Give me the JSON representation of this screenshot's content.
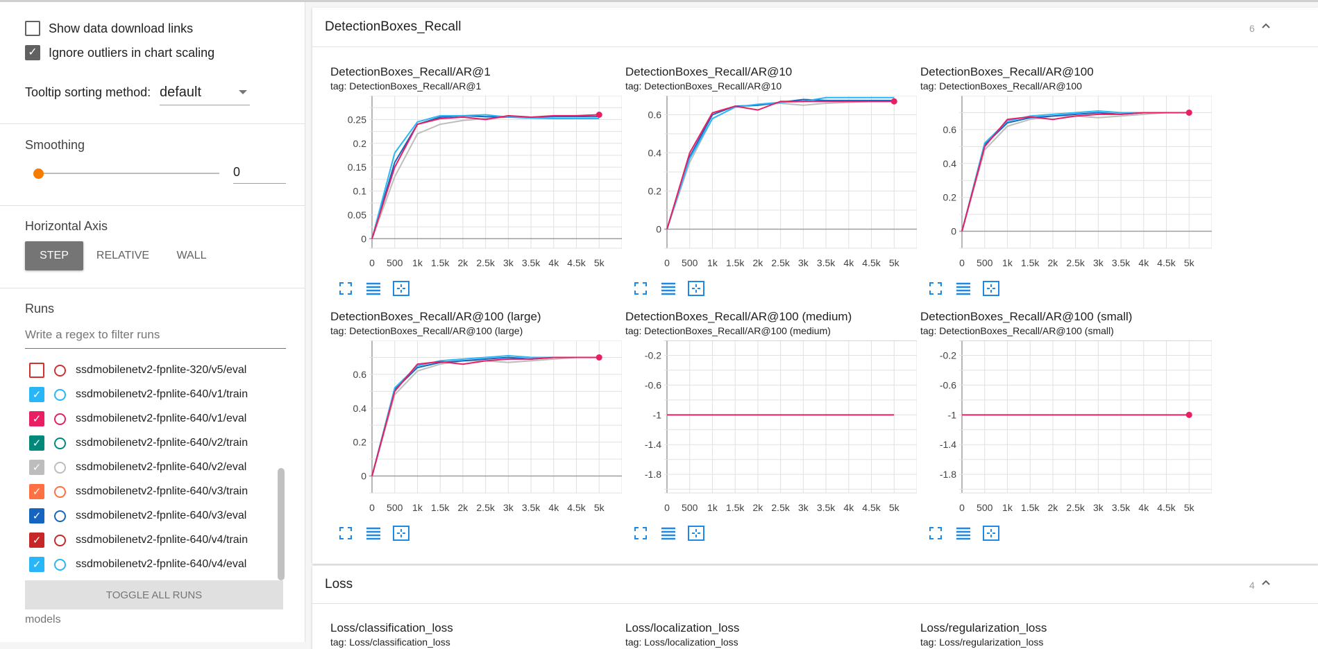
{
  "sidebar": {
    "show_download_links": "Show data download links",
    "ignore_outliers": "Ignore outliers in chart scaling",
    "tooltip_label": "Tooltip sorting method:",
    "tooltip_value": "default",
    "smoothing_label": "Smoothing",
    "smoothing_value": "0",
    "horizontal_axis_label": "Horizontal Axis",
    "axis_buttons": [
      "STEP",
      "RELATIVE",
      "WALL"
    ],
    "runs_label": "Runs",
    "runs_filter_placeholder": "Write a regex to filter runs",
    "runs": [
      {
        "name": "ssdmobilenetv2-fpnlite-320/v5/eval",
        "checked": false,
        "color": "#d32f2f"
      },
      {
        "name": "ssdmobilenetv2-fpnlite-640/v1/train",
        "checked": true,
        "color": "#29b6f6"
      },
      {
        "name": "ssdmobilenetv2-fpnlite-640/v1/eval",
        "checked": true,
        "color": "#e91e63"
      },
      {
        "name": "ssdmobilenetv2-fpnlite-640/v2/train",
        "checked": true,
        "color": "#00897b"
      },
      {
        "name": "ssdmobilenetv2-fpnlite-640/v2/eval",
        "checked": true,
        "color": "#bdbdbd"
      },
      {
        "name": "ssdmobilenetv2-fpnlite-640/v3/train",
        "checked": true,
        "color": "#ff7043"
      },
      {
        "name": "ssdmobilenetv2-fpnlite-640/v3/eval",
        "checked": true,
        "color": "#1565c0"
      },
      {
        "name": "ssdmobilenetv2-fpnlite-640/v4/train",
        "checked": true,
        "color": "#c62828"
      },
      {
        "name": "ssdmobilenetv2-fpnlite-640/v4/eval",
        "checked": true,
        "color": "#29b6f6"
      }
    ],
    "toggle_all": "TOGGLE ALL RUNS",
    "models": "models"
  },
  "sections": [
    {
      "title": "DetectionBoxes_Recall",
      "count": "6"
    },
    {
      "title": "Loss",
      "count": "4"
    }
  ],
  "loss_charts": [
    {
      "title": "Loss/classification_loss",
      "tag": "tag: Loss/classification_loss"
    },
    {
      "title": "Loss/localization_loss",
      "tag": "tag: Loss/localization_loss"
    },
    {
      "title": "Loss/regularization_loss",
      "tag": "tag: Loss/regularization_loss"
    }
  ],
  "colors": {
    "accent": "#f57c00",
    "series_blue": "#29b6f6",
    "series_pink": "#e91e63",
    "series_teal": "#00897b",
    "series_gray": "#bdbdbd",
    "series_darkblue": "#1565c0",
    "icon_blue": "#1e88e5"
  },
  "chart_data": [
    {
      "type": "line",
      "title": "DetectionBoxes_Recall/AR@1",
      "tag": "tag: DetectionBoxes_Recall/AR@1",
      "xticks": [
        "0",
        "500",
        "1k",
        "1.5k",
        "2k",
        "2.5k",
        "3k",
        "3.5k",
        "4k",
        "4.5k",
        "5k"
      ],
      "xlim": [
        0,
        5500
      ],
      "ylim": [
        -0.02,
        0.3
      ],
      "yticks": [
        0,
        0.05,
        0.1,
        0.15,
        0.2,
        0.25
      ],
      "yticklabels": [
        "0",
        "0.05",
        "0.1",
        "0.15",
        "0.2",
        "0.25"
      ],
      "series": [
        {
          "color": "#bdbdbd",
          "x": [
            0,
            500,
            1000,
            1500,
            2000,
            2500,
            3000,
            3500,
            4000,
            4500,
            5000
          ],
          "y": [
            0,
            0.13,
            0.22,
            0.24,
            0.248,
            0.252,
            0.255,
            0.255,
            0.256,
            0.258,
            0.26
          ]
        },
        {
          "color": "#1565c0",
          "x": [
            0,
            500,
            1000,
            1500,
            2000,
            2500,
            3000,
            3500,
            4000,
            4500,
            5000
          ],
          "y": [
            0,
            0.16,
            0.24,
            0.255,
            0.258,
            0.256,
            0.255,
            0.255,
            0.256,
            0.256,
            0.256
          ]
        },
        {
          "color": "#29b6f6",
          "x": [
            0,
            500,
            1000,
            1500,
            2000,
            2500,
            3000,
            3500,
            4000,
            4500,
            5000
          ],
          "y": [
            0,
            0.18,
            0.245,
            0.258,
            0.258,
            0.26,
            0.255,
            0.253,
            0.252,
            0.252,
            0.252
          ]
        },
        {
          "color": "#e91e63",
          "x": [
            0,
            500,
            1000,
            1500,
            2000,
            2500,
            3000,
            3500,
            4000,
            4500,
            5000
          ],
          "y": [
            0,
            0.15,
            0.24,
            0.252,
            0.255,
            0.25,
            0.258,
            0.255,
            0.258,
            0.258,
            0.26
          ],
          "marker": true
        }
      ]
    },
    {
      "type": "line",
      "title": "DetectionBoxes_Recall/AR@10",
      "tag": "tag: DetectionBoxes_Recall/AR@10",
      "xticks": [
        "0",
        "500",
        "1k",
        "1.5k",
        "2k",
        "2.5k",
        "3k",
        "3.5k",
        "4k",
        "4.5k",
        "5k"
      ],
      "xlim": [
        0,
        5500
      ],
      "ylim": [
        -0.1,
        0.7
      ],
      "yticks": [
        0,
        0.2,
        0.4,
        0.6
      ],
      "yticklabels": [
        "0",
        "0.2",
        "0.4",
        "0.6"
      ],
      "series": [
        {
          "color": "#bdbdbd",
          "x": [
            0,
            500,
            1000,
            1500,
            2000,
            2500,
            3000,
            3500,
            4000,
            4500,
            5000
          ],
          "y": [
            0,
            0.35,
            0.58,
            0.64,
            0.65,
            0.66,
            0.65,
            0.66,
            0.665,
            0.67,
            0.67
          ]
        },
        {
          "color": "#1565c0",
          "x": [
            0,
            500,
            1000,
            1500,
            2000,
            2500,
            3000,
            3500,
            4000,
            4500,
            5000
          ],
          "y": [
            0,
            0.38,
            0.6,
            0.645,
            0.65,
            0.665,
            0.68,
            0.675,
            0.675,
            0.675,
            0.675
          ]
        },
        {
          "color": "#29b6f6",
          "x": [
            0,
            500,
            1000,
            1500,
            2000,
            2500,
            3000,
            3500,
            4000,
            4500,
            5000
          ],
          "y": [
            0,
            0.37,
            0.58,
            0.64,
            0.655,
            0.665,
            0.67,
            0.69,
            0.69,
            0.69,
            0.69
          ]
        },
        {
          "color": "#e91e63",
          "x": [
            0,
            500,
            1000,
            1500,
            2000,
            2500,
            3000,
            3500,
            4000,
            4500,
            5000
          ],
          "y": [
            0,
            0.4,
            0.61,
            0.645,
            0.625,
            0.67,
            0.67,
            0.67,
            0.67,
            0.67,
            0.67
          ],
          "marker": true
        }
      ]
    },
    {
      "type": "line",
      "title": "DetectionBoxes_Recall/AR@100",
      "tag": "tag: DetectionBoxes_Recall/AR@100",
      "xticks": [
        "0",
        "500",
        "1k",
        "1.5k",
        "2k",
        "2.5k",
        "3k",
        "3.5k",
        "4k",
        "4.5k",
        "5k"
      ],
      "xlim": [
        0,
        5500
      ],
      "ylim": [
        -0.1,
        0.8
      ],
      "yticks": [
        0,
        0.2,
        0.4,
        0.6
      ],
      "yticklabels": [
        "0",
        "0.2",
        "0.4",
        "0.6"
      ],
      "series": [
        {
          "color": "#bdbdbd",
          "x": [
            0,
            500,
            1000,
            1500,
            2000,
            2500,
            3000,
            3500,
            4000,
            4500,
            5000
          ],
          "y": [
            0,
            0.48,
            0.62,
            0.66,
            0.68,
            0.68,
            0.67,
            0.68,
            0.69,
            0.7,
            0.7
          ]
        },
        {
          "color": "#1565c0",
          "x": [
            0,
            500,
            1000,
            1500,
            2000,
            2500,
            3000,
            3500,
            4000,
            4500,
            5000
          ],
          "y": [
            0,
            0.51,
            0.64,
            0.67,
            0.68,
            0.69,
            0.7,
            0.69,
            0.7,
            0.7,
            0.7
          ]
        },
        {
          "color": "#29b6f6",
          "x": [
            0,
            500,
            1000,
            1500,
            2000,
            2500,
            3000,
            3500,
            4000,
            4500,
            5000
          ],
          "y": [
            0,
            0.52,
            0.65,
            0.68,
            0.69,
            0.7,
            0.71,
            0.7,
            0.7,
            0.7,
            0.7
          ]
        },
        {
          "color": "#e91e63",
          "x": [
            0,
            500,
            1000,
            1500,
            2000,
            2500,
            3000,
            3500,
            4000,
            4500,
            5000
          ],
          "y": [
            0,
            0.5,
            0.66,
            0.675,
            0.66,
            0.68,
            0.69,
            0.69,
            0.7,
            0.7,
            0.7
          ],
          "marker": true
        }
      ]
    },
    {
      "type": "line",
      "title": "DetectionBoxes_Recall/AR@100 (large)",
      "tag": "tag: DetectionBoxes_Recall/AR@100 (large)",
      "xticks": [
        "0",
        "500",
        "1k",
        "1.5k",
        "2k",
        "2.5k",
        "3k",
        "3.5k",
        "4k",
        "4.5k",
        "5k"
      ],
      "xlim": [
        0,
        5500
      ],
      "ylim": [
        -0.1,
        0.8
      ],
      "yticks": [
        0,
        0.2,
        0.4,
        0.6
      ],
      "yticklabels": [
        "0",
        "0.2",
        "0.4",
        "0.6"
      ],
      "series": [
        {
          "color": "#bdbdbd",
          "x": [
            0,
            500,
            1000,
            1500,
            2000,
            2500,
            3000,
            3500,
            4000,
            4500,
            5000
          ],
          "y": [
            0,
            0.48,
            0.62,
            0.66,
            0.68,
            0.68,
            0.67,
            0.68,
            0.69,
            0.7,
            0.7
          ]
        },
        {
          "color": "#1565c0",
          "x": [
            0,
            500,
            1000,
            1500,
            2000,
            2500,
            3000,
            3500,
            4000,
            4500,
            5000
          ],
          "y": [
            0,
            0.51,
            0.64,
            0.67,
            0.68,
            0.69,
            0.7,
            0.69,
            0.7,
            0.7,
            0.7
          ]
        },
        {
          "color": "#29b6f6",
          "x": [
            0,
            500,
            1000,
            1500,
            2000,
            2500,
            3000,
            3500,
            4000,
            4500,
            5000
          ],
          "y": [
            0,
            0.52,
            0.65,
            0.68,
            0.69,
            0.7,
            0.71,
            0.7,
            0.7,
            0.7,
            0.7
          ]
        },
        {
          "color": "#e91e63",
          "x": [
            0,
            500,
            1000,
            1500,
            2000,
            2500,
            3000,
            3500,
            4000,
            4500,
            5000
          ],
          "y": [
            0,
            0.5,
            0.66,
            0.675,
            0.66,
            0.68,
            0.69,
            0.69,
            0.7,
            0.7,
            0.7
          ],
          "marker": true
        }
      ]
    },
    {
      "type": "line",
      "title": "DetectionBoxes_Recall/AR@100 (medium)",
      "tag": "tag: DetectionBoxes_Recall/AR@100 (medium)",
      "xticks": [
        "0",
        "500",
        "1k",
        "1.5k",
        "2k",
        "2.5k",
        "3k",
        "3.5k",
        "4k",
        "4.5k",
        "5k"
      ],
      "xlim": [
        0,
        5500
      ],
      "ylim": [
        -2.05,
        0.0
      ],
      "yticks": [
        -0.2,
        -0.6,
        -1,
        -1.4,
        -1.8
      ],
      "yticklabels": [
        "-0.2",
        "-0.6",
        "-1",
        "-1.4",
        "-1.8"
      ],
      "series": [
        {
          "color": "#e91e63",
          "x": [
            0,
            5000
          ],
          "y": [
            -1,
            -1
          ],
          "marker": false
        }
      ]
    },
    {
      "type": "line",
      "title": "DetectionBoxes_Recall/AR@100 (small)",
      "tag": "tag: DetectionBoxes_Recall/AR@100 (small)",
      "xticks": [
        "0",
        "500",
        "1k",
        "1.5k",
        "2k",
        "2.5k",
        "3k",
        "3.5k",
        "4k",
        "4.5k",
        "5k"
      ],
      "xlim": [
        0,
        5500
      ],
      "ylim": [
        -2.05,
        0.0
      ],
      "yticks": [
        -0.2,
        -0.6,
        -1,
        -1.4,
        -1.8
      ],
      "yticklabels": [
        "-0.2",
        "-0.6",
        "-1",
        "-1.4",
        "-1.8"
      ],
      "series": [
        {
          "color": "#e91e63",
          "x": [
            0,
            5000
          ],
          "y": [
            -1,
            -1
          ],
          "marker": true
        }
      ]
    }
  ]
}
